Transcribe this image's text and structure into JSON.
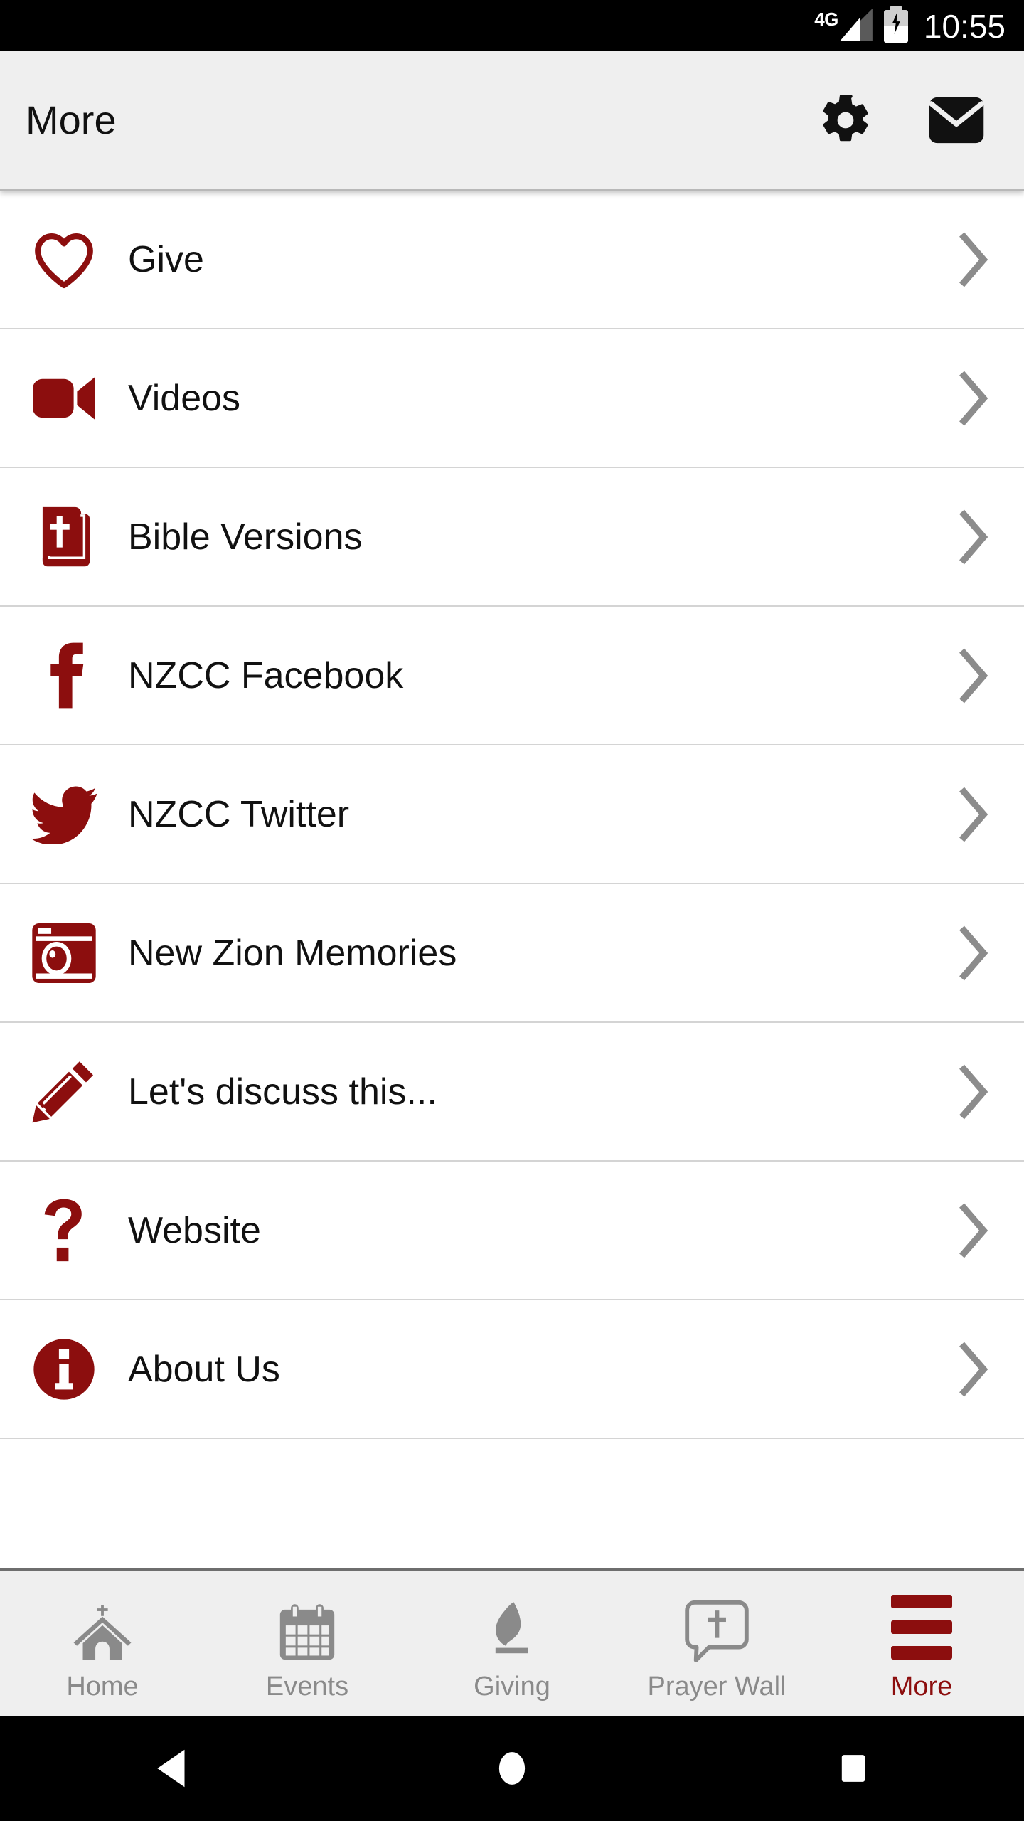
{
  "status_bar": {
    "network_type": "4G",
    "time": "10:55",
    "battery_state": "charging",
    "icons": [
      "signal-icon",
      "battery-charging-icon"
    ]
  },
  "app_bar": {
    "title": "More",
    "actions": [
      {
        "name": "settings-button",
        "icon": "gear-icon",
        "label": "Settings"
      },
      {
        "name": "mail-button",
        "icon": "envelope-icon",
        "label": "Mail"
      }
    ]
  },
  "theme": {
    "accent": "#8C0E0E",
    "bar_background": "#efefef",
    "divider": "#d4d4d4",
    "inactive_tab": "#8a8a8a",
    "chevron": "#8c8c8c"
  },
  "list": {
    "items": [
      {
        "label": "Give",
        "icon": "heart-outline-icon",
        "chevron": "chevron-right-icon"
      },
      {
        "label": "Videos",
        "icon": "video-camera-icon",
        "chevron": "chevron-right-icon"
      },
      {
        "label": "Bible Versions",
        "icon": "bible-book-icon",
        "chevron": "chevron-right-icon"
      },
      {
        "label": "NZCC Facebook",
        "icon": "facebook-icon",
        "chevron": "chevron-right-icon"
      },
      {
        "label": "NZCC Twitter",
        "icon": "twitter-bird-icon",
        "chevron": "chevron-right-icon"
      },
      {
        "label": "New Zion Memories",
        "icon": "camera-icon",
        "chevron": "chevron-right-icon"
      },
      {
        "label": "Let's discuss this...",
        "icon": "pencil-icon",
        "chevron": "chevron-right-icon"
      },
      {
        "label": "Website",
        "icon": "question-mark-icon",
        "chevron": "chevron-right-icon"
      },
      {
        "label": "About Us",
        "icon": "info-circle-icon",
        "chevron": "chevron-right-icon"
      }
    ]
  },
  "tab_bar": {
    "active_index": 4,
    "tabs": [
      {
        "label": "Home",
        "icon": "church-icon"
      },
      {
        "label": "Events",
        "icon": "calendar-icon"
      },
      {
        "label": "Giving",
        "icon": "flame-icon"
      },
      {
        "label": "Prayer Wall",
        "icon": "speech-bubble-cross-icon"
      },
      {
        "label": "More",
        "icon": "hamburger-menu-icon"
      }
    ]
  },
  "system_nav": {
    "buttons": [
      {
        "name": "back-button",
        "icon": "triangle-back-icon"
      },
      {
        "name": "home-button",
        "icon": "circle-home-icon"
      },
      {
        "name": "recents-button",
        "icon": "square-recents-icon"
      }
    ]
  }
}
